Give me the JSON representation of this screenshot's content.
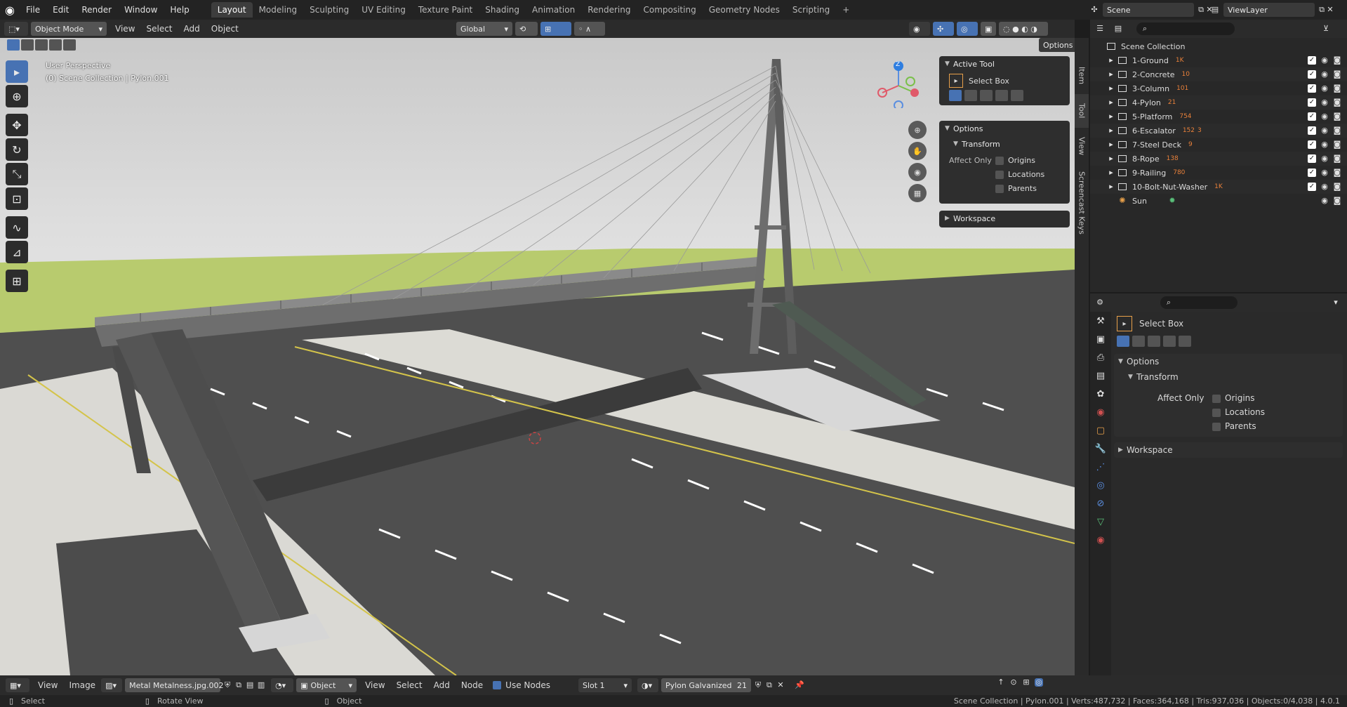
{
  "topbar": {
    "menus": [
      "File",
      "Edit",
      "Render",
      "Window",
      "Help"
    ],
    "workspaces": [
      "Layout",
      "Modeling",
      "Sculpting",
      "UV Editing",
      "Texture Paint",
      "Shading",
      "Animation",
      "Rendering",
      "Compositing",
      "Geometry Nodes",
      "Scripting"
    ],
    "add_tab": "+",
    "scene": "Scene",
    "view_layer": "ViewLayer"
  },
  "viewport_header": {
    "mode": "Object Mode",
    "menus": [
      "View",
      "Select",
      "Add",
      "Object"
    ],
    "orientation": "Global",
    "options": "Options"
  },
  "viewport": {
    "perspective_label": "User Perspective",
    "collection_label": "(0) Scene Collection | Pylon.001",
    "gizmo_z": "Z"
  },
  "tool_panel": {
    "active_tool_title": "Active Tool",
    "tool_name": "Select Box",
    "options_title": "Options",
    "transform_title": "Transform",
    "affect_only": "Affect Only",
    "origins": "Origins",
    "locations": "Locations",
    "parents": "Parents",
    "workspace": "Workspace"
  },
  "side_tabs": [
    "Item",
    "Tool",
    "View",
    "Screencast Keys"
  ],
  "outliner": {
    "root": "Scene Collection",
    "items": [
      {
        "name": "1-Ground",
        "badge": "1K"
      },
      {
        "name": "2-Concrete",
        "badge": "10"
      },
      {
        "name": "3-Column",
        "badge": "101"
      },
      {
        "name": "4-Pylon",
        "badge": "21"
      },
      {
        "name": "5-Platform",
        "badge": "754"
      },
      {
        "name": "6-Escalator",
        "badge": "152",
        "badge2": "3"
      },
      {
        "name": "7-Steel Deck",
        "badge": "9"
      },
      {
        "name": "8-Rope",
        "badge": "138"
      },
      {
        "name": "9-Railing",
        "badge": "780"
      },
      {
        "name": "10-Bolt-Nut-Washer",
        "badge": "1K"
      },
      {
        "name": "Sun",
        "badge": ""
      }
    ]
  },
  "properties": {
    "tool_name": "Select Box",
    "options_title": "Options",
    "transform_title": "Transform",
    "affect_only": "Affect Only",
    "origins": "Origins",
    "locations": "Locations",
    "parents": "Parents",
    "workspace": "Workspace"
  },
  "bottom_header": {
    "menus_left": [
      "View",
      "Image"
    ],
    "image_name": "Metal Metalness.jpg.002",
    "object_type": "Object",
    "menus_right": [
      "View",
      "Select",
      "Add",
      "Node"
    ],
    "use_nodes": "Use Nodes",
    "slot": "Slot 1",
    "material": "Pylon Galvanized",
    "user_count": "21"
  },
  "statusbar": {
    "select": "Select",
    "rotate": "Rotate View",
    "object": "Object",
    "stats": "Scene Collection | Pylon.001 | Verts:487,732 | Faces:364,168 | Tris:937,036 | Objects:0/4,038 | 4.0.1"
  },
  "colors": {
    "accent": "#4772b3",
    "panel": "#2e2e2e",
    "badge": "#e8803a",
    "grass": "#b5c96b",
    "asphalt": "#4a4a4a"
  }
}
